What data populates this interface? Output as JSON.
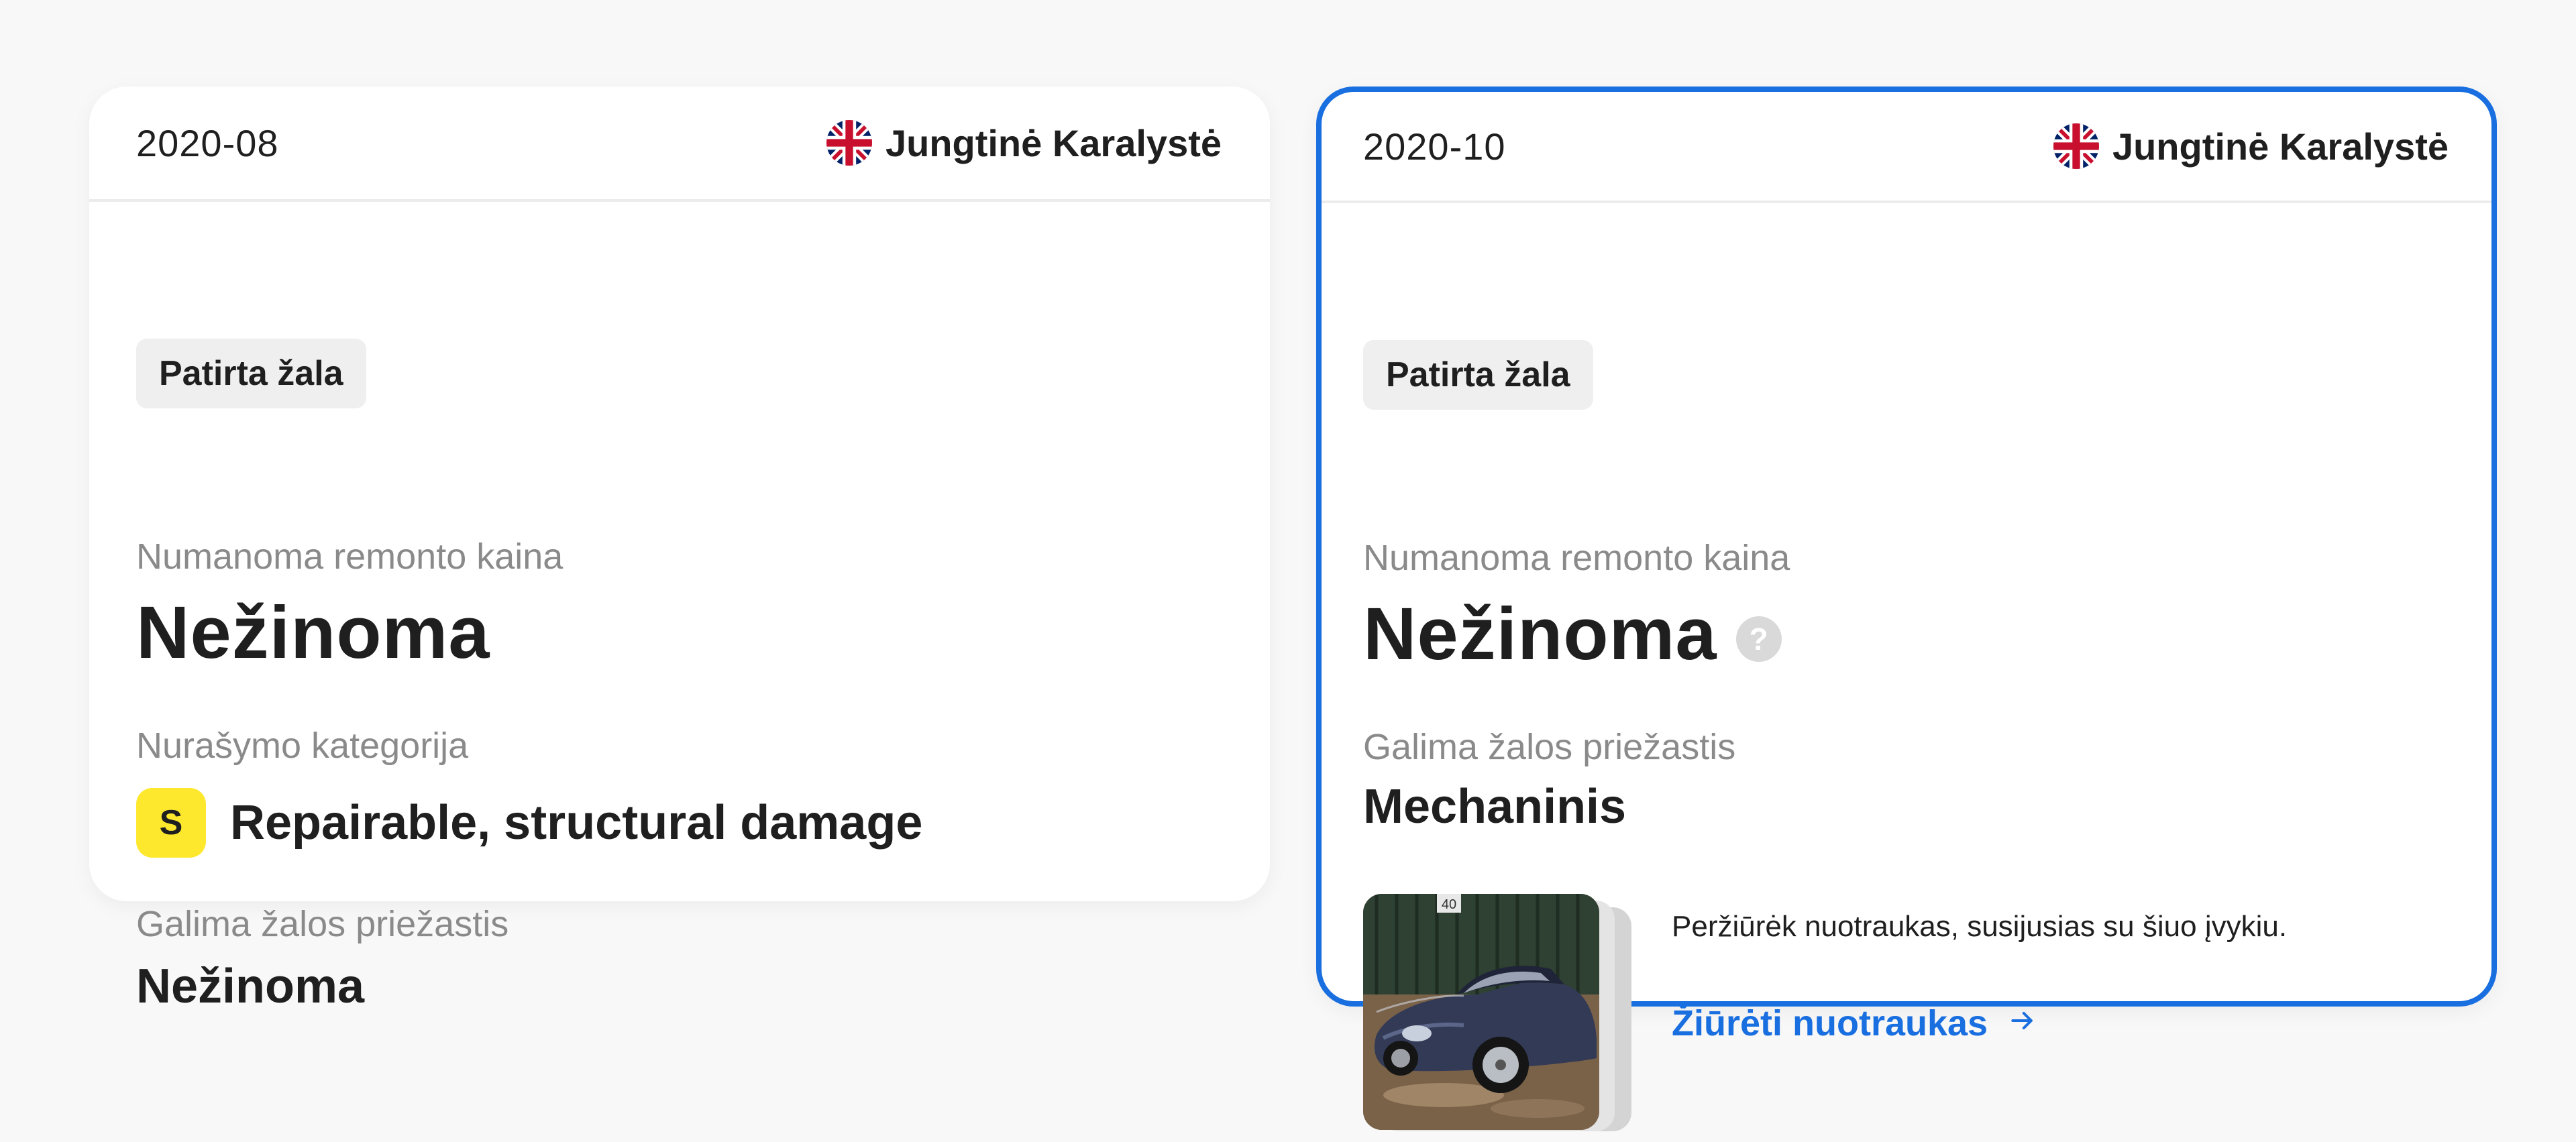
{
  "colors": {
    "accent": "#1a6fe0",
    "category_badge": "#fde82e",
    "badge_bg": "#efefef",
    "label_gray": "#8a8a8a"
  },
  "cards": [
    {
      "date": "2020-08",
      "country": "Jungtinė Karalystė",
      "flag_icon": "uk-flag-icon",
      "badge": "Patirta žala",
      "repair_label": "Numanoma remonto kaina",
      "repair_value": "Nežinoma",
      "category_label": "Nurašymo kategorija",
      "category_letter": "S",
      "category_value": "Repairable, structural damage",
      "cause_label": "Galima žalos priežastis",
      "cause_value": "Nežinoma"
    },
    {
      "date": "2020-10",
      "country": "Jungtinė Karalystė",
      "flag_icon": "uk-flag-icon",
      "badge": "Patirta žala",
      "repair_label": "Numanoma remonto kaina",
      "repair_value": "Nežinoma",
      "help_icon": "?",
      "cause_label": "Galima žalos priežastis",
      "cause_value": "Mechaninis",
      "photos_text": "Peržiūrėk nuotraukas, susijusias su šiuo įvykiu.",
      "photos_link": "Žiūrėti nuotraukas",
      "photo_sign": "40",
      "selected": true
    }
  ]
}
